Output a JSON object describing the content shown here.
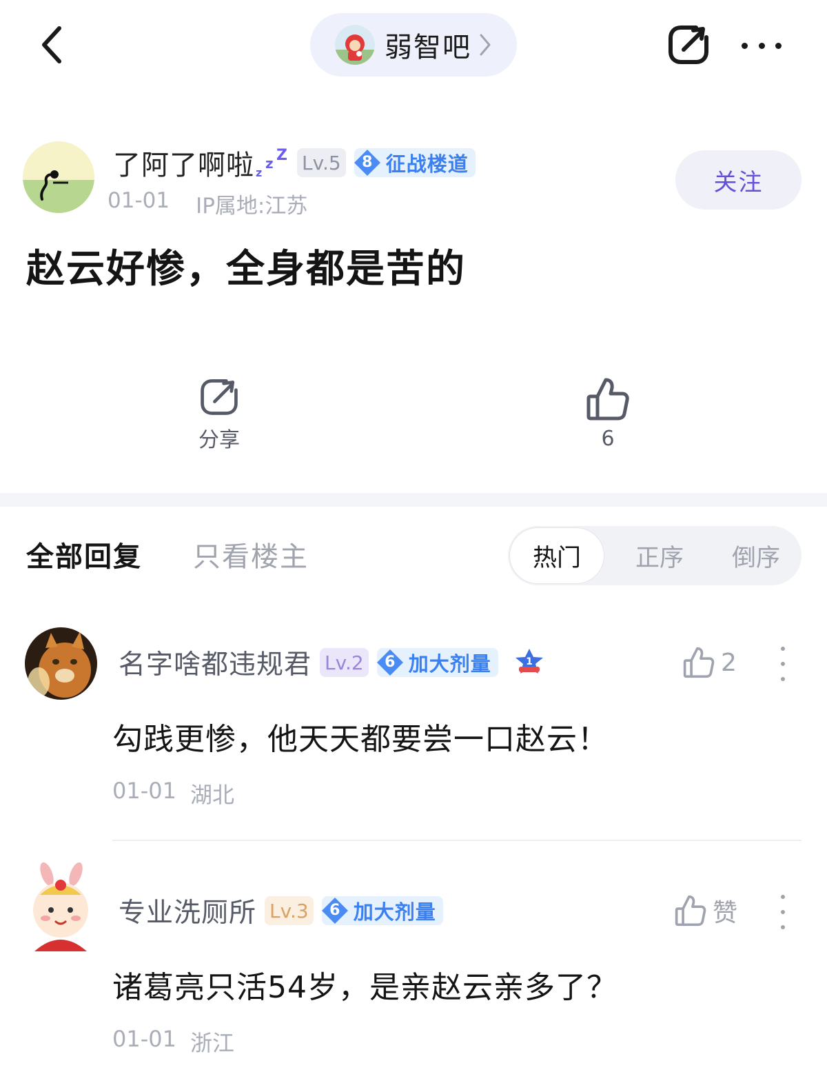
{
  "topbar": {
    "back_icon": "chevron-left-icon",
    "forum_name": "弱智吧",
    "forum_chevron_icon": "chevron-right-icon",
    "share_icon": "share-icon",
    "more_icon": "more-horizontal-icon"
  },
  "post": {
    "author": {
      "name": "了阿了啊啦",
      "sleep_icon": "zzz-icon",
      "level": "Lv.5",
      "badge_number": "8",
      "badge_label": "征战楼道",
      "date": "01-01",
      "ip_location": "IP属地:江苏"
    },
    "follow_label": "关注",
    "title": "赵云好惨，全身都是苦的",
    "actions": {
      "share_label": "分享",
      "like_count": "6"
    }
  },
  "reply_tabs": {
    "all_label": "全部回复",
    "owner_only_label": "只看楼主",
    "sort": {
      "hot": "热门",
      "ascending": "正序",
      "descending": "倒序",
      "selected": "热门"
    }
  },
  "comments": [
    {
      "name": "名字啥都违规君",
      "level": "Lv.2",
      "badge_number": "6",
      "badge_label": "加大剂量",
      "rank_icon": "rank-1-badge-icon",
      "like_count": "2",
      "text": "勾践更惨，他天天都要尝一口赵云！",
      "date": "01-01",
      "location": "湖北"
    },
    {
      "name": "专业洗厕所",
      "level": "Lv.3",
      "badge_number": "6",
      "badge_label": "加大剂量",
      "like_label": "赞",
      "text": "诸葛亮只活54岁，是亲赵云亲多了？",
      "date": "01-01",
      "location": "浙江"
    }
  ],
  "colors": {
    "accent_purple": "#6450d8",
    "badge_blue": "#3a80f0",
    "muted_gray": "#a9adb8"
  }
}
